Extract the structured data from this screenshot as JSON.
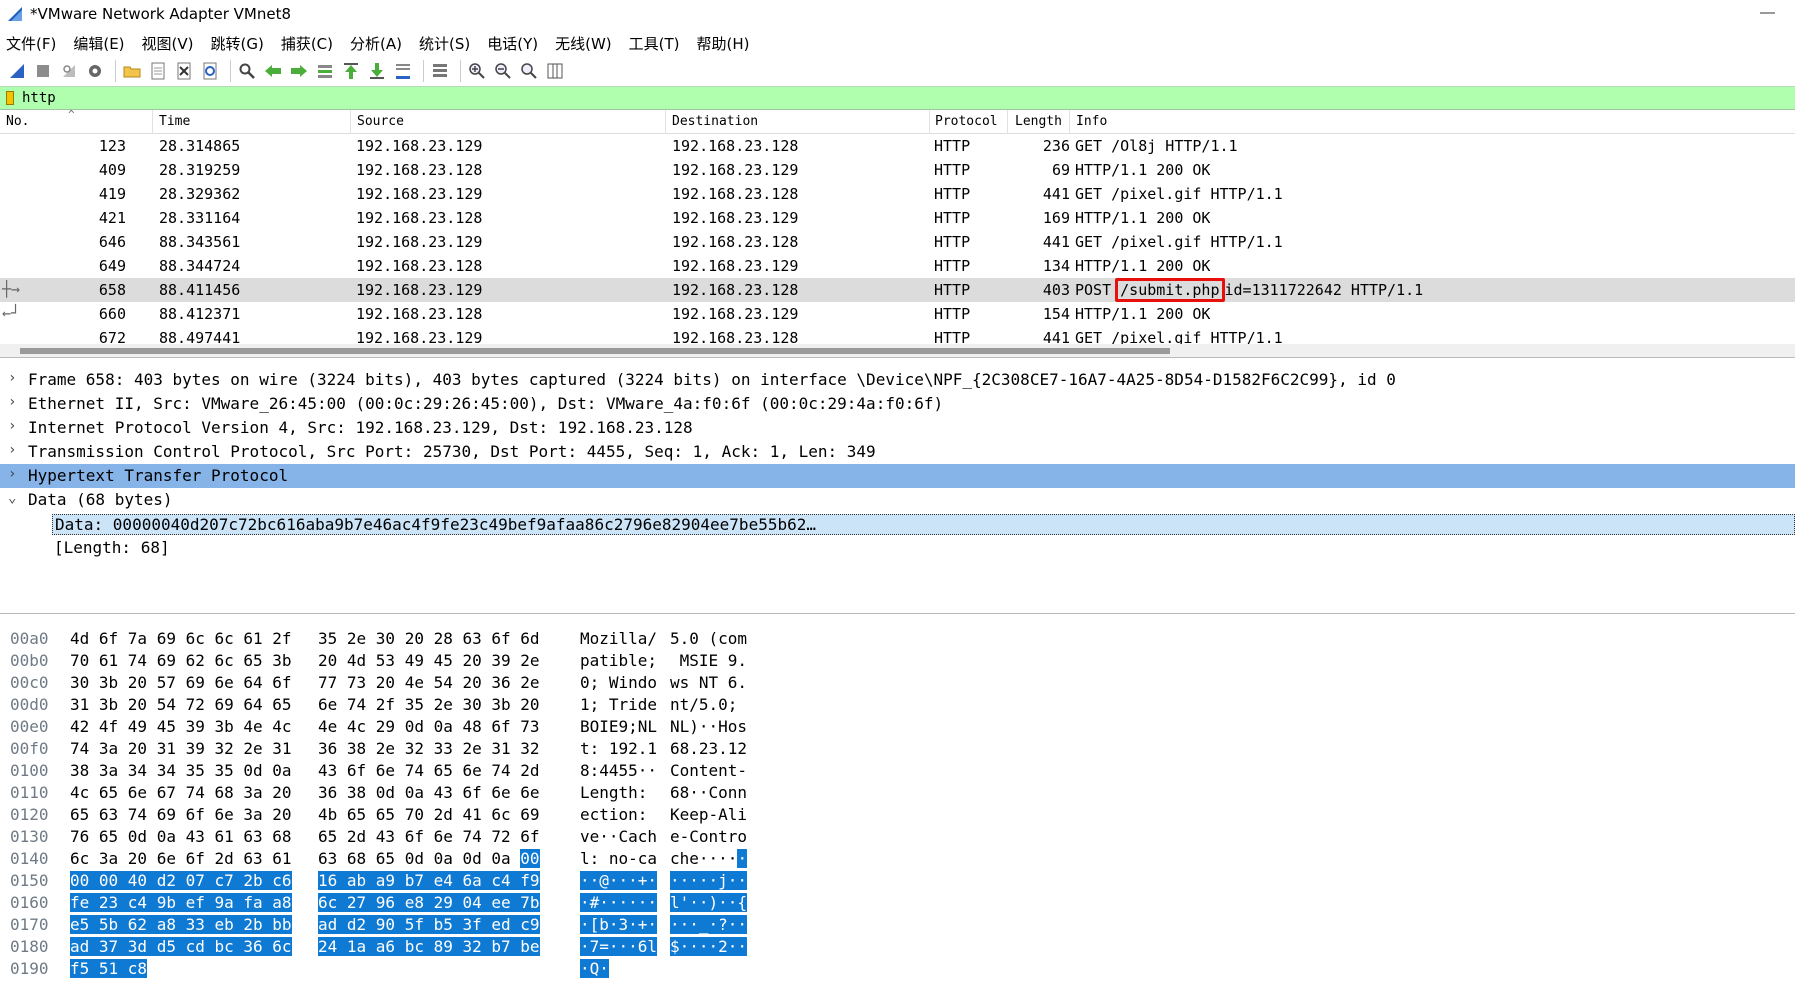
{
  "window": {
    "title": "*VMware Network Adapter VMnet8"
  },
  "menu": [
    "文件(F)",
    "编辑(E)",
    "视图(V)",
    "跳转(G)",
    "捕获(C)",
    "分析(A)",
    "统计(S)",
    "电话(Y)",
    "无线(W)",
    "工具(T)",
    "帮助(H)"
  ],
  "toolbar": {
    "icons": [
      "shark-fin-start-icon",
      "stop-square-icon",
      "restart-icon",
      "options-gear-icon",
      "open-folder-icon",
      "save-file-icon",
      "close-file-icon",
      "reload-icon",
      "find-magnifier-icon",
      "go-back-arrow-icon",
      "go-forward-arrow-icon",
      "go-to-packet-icon",
      "go-first-icon",
      "go-last-icon",
      "autoscroll-icon",
      "colorize-icon",
      "zoom-in-icon",
      "zoom-out-icon",
      "zoom-normal-icon",
      "resize-columns-icon"
    ]
  },
  "filter": {
    "value": "http",
    "bar_color": "#afffaf"
  },
  "packet_list": {
    "columns": [
      "No.",
      "Time",
      "Source",
      "Destination",
      "Protocol",
      "Length",
      "Info"
    ],
    "rows": [
      {
        "no": "123",
        "time": "28.314865",
        "src": "192.168.23.129",
        "dst": "192.168.23.128",
        "proto": "HTTP",
        "len": "236",
        "info": "GET /Ol8j HTTP/1.1"
      },
      {
        "no": "409",
        "time": "28.319259",
        "src": "192.168.23.128",
        "dst": "192.168.23.129",
        "proto": "HTTP",
        "len": "69",
        "info": "HTTP/1.1 200 OK"
      },
      {
        "no": "419",
        "time": "28.329362",
        "src": "192.168.23.129",
        "dst": "192.168.23.128",
        "proto": "HTTP",
        "len": "441",
        "info": "GET /pixel.gif HTTP/1.1"
      },
      {
        "no": "421",
        "time": "28.331164",
        "src": "192.168.23.128",
        "dst": "192.168.23.129",
        "proto": "HTTP",
        "len": "169",
        "info": "HTTP/1.1 200 OK"
      },
      {
        "no": "646",
        "time": "88.343561",
        "src": "192.168.23.129",
        "dst": "192.168.23.128",
        "proto": "HTTP",
        "len": "441",
        "info": "GET /pixel.gif HTTP/1.1"
      },
      {
        "no": "649",
        "time": "88.344724",
        "src": "192.168.23.128",
        "dst": "192.168.23.129",
        "proto": "HTTP",
        "len": "134",
        "info": "HTTP/1.1 200 OK"
      },
      {
        "no": "658",
        "time": "88.411456",
        "src": "192.168.23.129",
        "dst": "192.168.23.128",
        "proto": "HTTP",
        "len": "403",
        "info_method": "POST",
        "info_uri": "/submit.php",
        "info_rest": "id=1311722642 HTTP/1.1"
      },
      {
        "no": "660",
        "time": "88.412371",
        "src": "192.168.23.128",
        "dst": "192.168.23.129",
        "proto": "HTTP",
        "len": "154",
        "info": "HTTP/1.1 200 OK"
      },
      {
        "no": "672",
        "time": "88.497441",
        "src": "192.168.23.129",
        "dst": "192.168.23.128",
        "proto": "HTTP",
        "len": "441",
        "info": "GET /pixel.gif HTTP/1.1"
      }
    ]
  },
  "details": [
    {
      "expander": "›",
      "text": "Frame 658: 403 bytes on wire (3224 bits), 403 bytes captured (3224 bits) on interface \\Device\\NPF_{2C308CE7-16A7-4A25-8D54-D1582F6C2C99}, id 0"
    },
    {
      "expander": "›",
      "text": "Ethernet II, Src: VMware_26:45:00 (00:0c:29:26:45:00), Dst: VMware_4a:f0:6f (00:0c:29:4a:f0:6f)"
    },
    {
      "expander": "›",
      "text": "Internet Protocol Version 4, Src: 192.168.23.129, Dst: 192.168.23.128"
    },
    {
      "expander": "›",
      "text": "Transmission Control Protocol, Src Port: 25730, Dst Port: 4455, Seq: 1, Ack: 1, Len: 349"
    },
    {
      "expander": "›",
      "text": "Hypertext Transfer Protocol"
    },
    {
      "expander": "⌄",
      "text": "Data (68 bytes)"
    },
    {
      "expander": "",
      "text": "Data: 00000040d207c72bc616aba9b7e46ac4f9fe23c49bef9afaa86c2796e82904ee7be55b62…"
    },
    {
      "expander": "",
      "text": "[Length: 68]"
    }
  ],
  "bytes": [
    {
      "off": "00a0",
      "h1": "4d 6f 7a 69 6c 6c 61 2f",
      "h2": "35 2e 30 20 28 63 6f 6d",
      "a1": "Mozilla/",
      "a2": "5.0 (com"
    },
    {
      "off": "00b0",
      "h1": "70 61 74 69 62 6c 65 3b",
      "h2": "20 4d 53 49 45 20 39 2e",
      "a1": "patible;",
      "a2": " MSIE 9."
    },
    {
      "off": "00c0",
      "h1": "30 3b 20 57 69 6e 64 6f",
      "h2": "77 73 20 4e 54 20 36 2e",
      "a1": "0; Windo",
      "a2": "ws NT 6."
    },
    {
      "off": "00d0",
      "h1": "31 3b 20 54 72 69 64 65",
      "h2": "6e 74 2f 35 2e 30 3b 20",
      "a1": "1; Tride",
      "a2": "nt/5.0; "
    },
    {
      "off": "00e0",
      "h1": "42 4f 49 45 39 3b 4e 4c",
      "h2": "4e 4c 29 0d 0a 48 6f 73",
      "a1": "BOIE9;NL",
      "a2": "NL)··Hos"
    },
    {
      "off": "00f0",
      "h1": "74 3a 20 31 39 32 2e 31",
      "h2": "36 38 2e 32 33 2e 31 32",
      "a1": "t: 192.1",
      "a2": "68.23.12"
    },
    {
      "off": "0100",
      "h1": "38 3a 34 34 35 35 0d 0a",
      "h2": "43 6f 6e 74 65 6e 74 2d",
      "a1": "8:4455··",
      "a2": "Content-"
    },
    {
      "off": "0110",
      "h1": "4c 65 6e 67 74 68 3a 20",
      "h2": "36 38 0d 0a 43 6f 6e 6e",
      "a1": "Length: ",
      "a2": "68··Conn"
    },
    {
      "off": "0120",
      "h1": "65 63 74 69 6f 6e 3a 20",
      "h2": "4b 65 65 70 2d 41 6c 69",
      "a1": "ection: ",
      "a2": "Keep-Ali"
    },
    {
      "off": "0130",
      "h1": "76 65 0d 0a 43 61 63 68",
      "h2": "65 2d 43 6f 6e 74 72 6f",
      "a1": "ve··Cach",
      "a2": "e-Contro"
    },
    {
      "off": "0140",
      "h1": "6c 3a 20 6e 6f 2d 63 61",
      "h2": "63 68 65 0d 0a 0d 0a ",
      "h2s": "00",
      "a1": "l: no-ca",
      "a2": "che····",
      "a2s": "·"
    },
    {
      "off": "0150",
      "h1s": "00 00 40 d2 07 c7 2b c6",
      "h2s": "16 ab a9 b7 e4 6a c4 f9",
      "a1s": "··@···+·",
      "a2s": "·····j··"
    },
    {
      "off": "0160",
      "h1s": "fe 23 c4 9b ef 9a fa a8",
      "h2s": "6c 27 96 e8 29 04 ee 7b",
      "a1s": "·#······",
      "a2s": "l'··)··{"
    },
    {
      "off": "0170",
      "h1s": "e5 5b 62 a8 33 eb 2b bb",
      "h2s": "ad d2 90 5f b5 3f ed c9",
      "a1s": "·[b·3·+·",
      "a2s": "···_·?··"
    },
    {
      "off": "0180",
      "h1s": "ad 37 3d d5 cd bc 36 6c",
      "h2s": "24 1a a6 bc 89 32 b7 be",
      "a1s": "·7=···6l",
      "a2s": "$····2··"
    },
    {
      "off": "0190",
      "h1s": "f5 51 c8",
      "a1s": "·Q·"
    }
  ],
  "colors": {
    "selected_row": "#dcdcdc",
    "detail_highlight": "#86b4e8",
    "byte_selection": "#0f7ad4",
    "annotation_box": "#e8100c"
  }
}
